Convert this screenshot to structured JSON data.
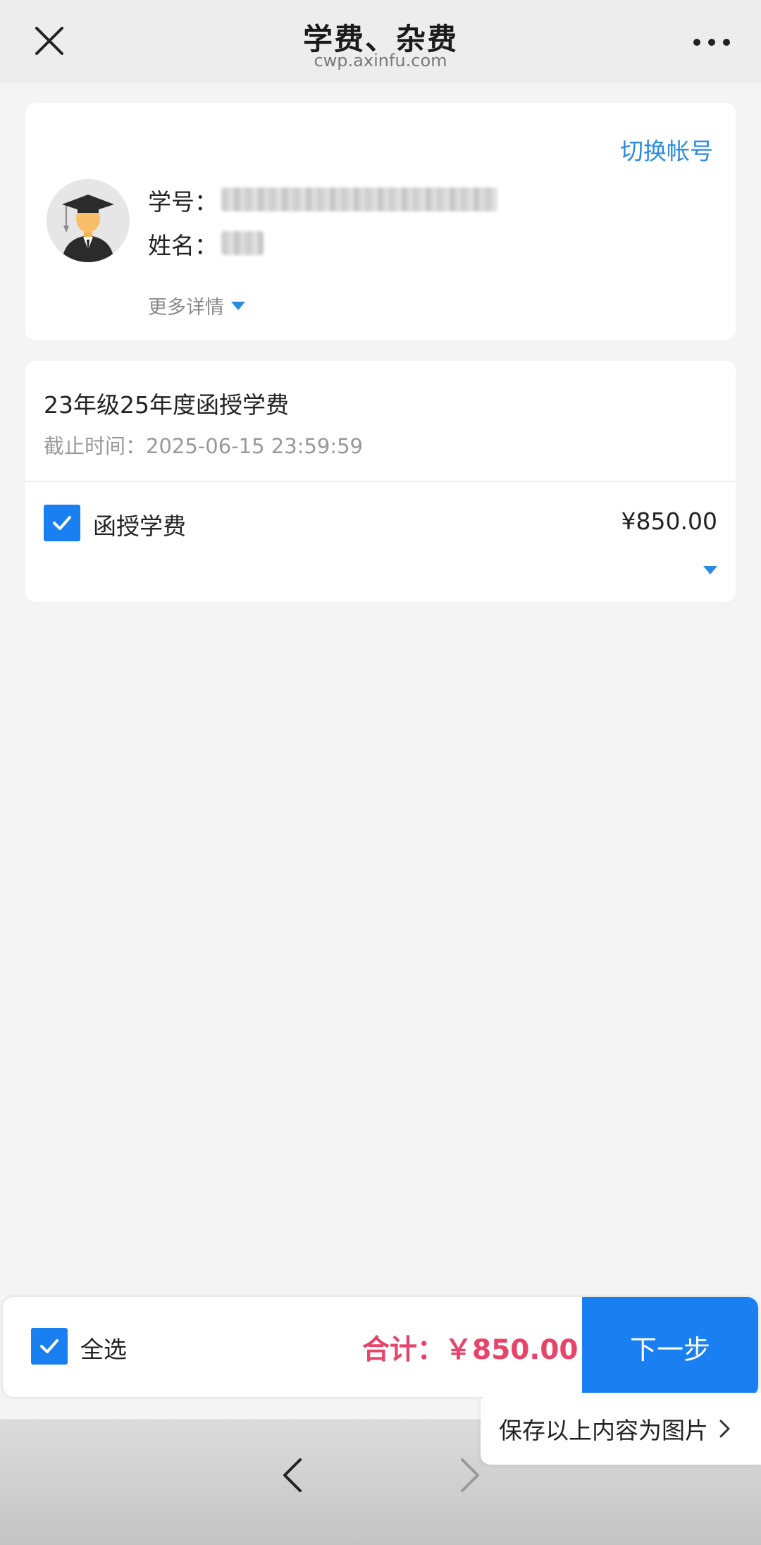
{
  "header": {
    "title": "学费、杂费",
    "url": "cwp.axinfu.com"
  },
  "user_card": {
    "switch_account": "切换帐号",
    "student_id_label": "学号：",
    "name_label": "姓名：",
    "more_details": "更多详情"
  },
  "fee_card": {
    "title": "23年级25年度函授学费",
    "deadline": "截止时间：2025-06-15 23:59:59",
    "items": [
      {
        "name": "函授学费",
        "price": "¥850.00",
        "checked": true
      }
    ]
  },
  "bottom_bar": {
    "select_all": "全选",
    "select_all_checked": true,
    "total": "合计：￥850.00",
    "next_button": "下一步"
  },
  "save_tip": "保存以上内容为图片",
  "colors": {
    "accent_blue": "#1a7ff0",
    "link_blue": "#2a8be0",
    "total_red": "#e8446a"
  }
}
